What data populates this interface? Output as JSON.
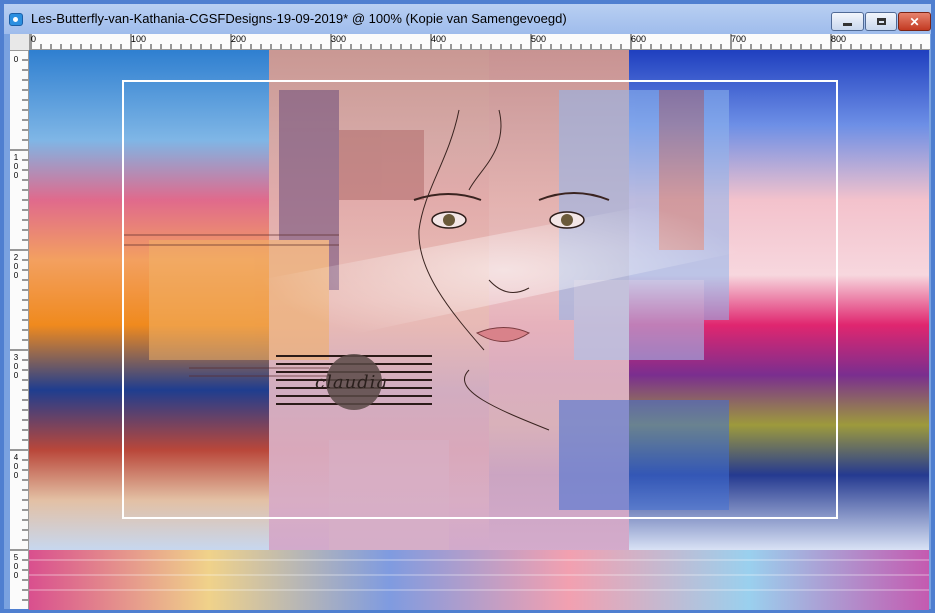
{
  "window": {
    "title": "Les-Butterfly-van-Kathania-CGSFDesigns-19-09-2019* @ 100% (Kopie van Samengevoegd)",
    "controls": {
      "minimize": "",
      "maximize": "",
      "close": "✕"
    }
  },
  "ruler_horizontal": {
    "labels": [
      "0",
      "100",
      "200",
      "300",
      "400",
      "500",
      "600",
      "700",
      "800"
    ]
  },
  "ruler_vertical": {
    "labels": [
      "0",
      "100",
      "200",
      "300",
      "400",
      "500"
    ]
  },
  "canvas": {
    "signature": "claudia",
    "colors": {
      "frame": "#ffffff",
      "sky_blue": "#3a8ad6",
      "orange": "#f08a2a",
      "pink": "#e8287a",
      "skin": "#e9b5a9"
    }
  }
}
